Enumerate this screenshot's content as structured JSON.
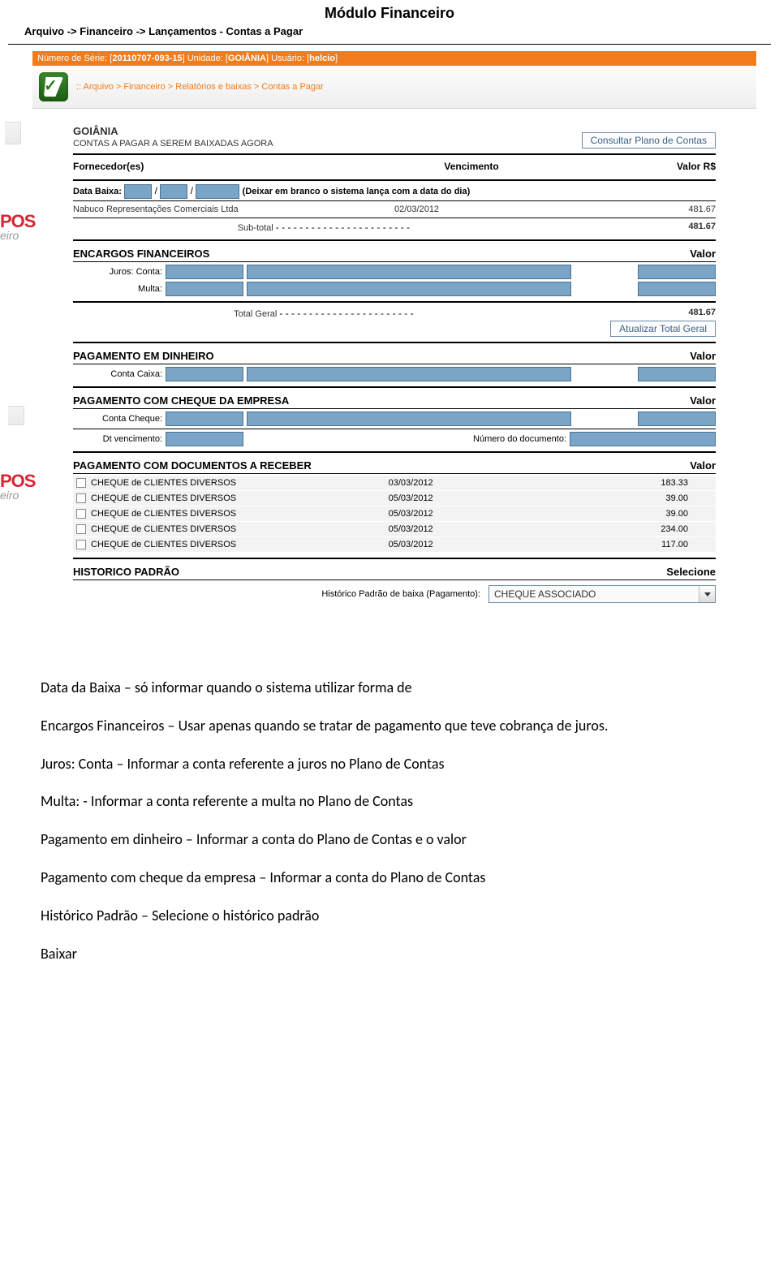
{
  "doc": {
    "title": "Módulo Financeiro",
    "path": "Arquivo -> Financeiro -> Lançamentos - Contas a Pagar"
  },
  "header": {
    "serial_label": "Número de Série:",
    "serial": "20110707-093-15",
    "unit_label": "Unidade:",
    "unit": "GOIÂNIA",
    "user_label": "Usuário:",
    "user": "helcio"
  },
  "breadcrumb": ":: Arquivo > Financeiro > Relatórios e baixas > Contas a Pagar",
  "main": {
    "unit_name": "GOIÂNIA",
    "subtitle": "CONTAS A PAGAR A SEREM BAIXADAS AGORA",
    "btn_plano": "Consultar Plano de Contas",
    "cols": {
      "fornecedor": "Fornecedor(es)",
      "vencimento": "Vencimento",
      "valor": "Valor R$"
    },
    "data_baixa_label": "Data Baixa:",
    "data_baixa_hint": "(Deixar em branco o sistema lança com a data do dia)",
    "fornecedor_row": {
      "name": "Nabuco Representações Comerciais Ltda",
      "date": "02/03/2012",
      "value": "481.67"
    },
    "subtotal_label": "Sub-total",
    "subtotal_value": "481.67",
    "encargos_title": "ENCARGOS FINANCEIROS",
    "valor_label": "Valor",
    "juros_label": "Juros: Conta:",
    "multa_label": "Multa:",
    "total_label": "Total Geral",
    "total_value": "481.67",
    "btn_atualizar": "Atualizar Total Geral",
    "pag_dinheiro_title": "PAGAMENTO EM DINHEIRO",
    "conta_caixa_label": "Conta Caixa:",
    "pag_cheque_title": "PAGAMENTO COM CHEQUE DA EMPRESA",
    "conta_cheque_label": "Conta Cheque:",
    "dt_venc_label": "Dt vencimento:",
    "num_doc_label": "Número do documento:",
    "pag_docs_title": "PAGAMENTO COM DOCUMENTOS A RECEBER",
    "docs": [
      {
        "name": "CHEQUE de CLIENTES DIVERSOS",
        "date": "03/03/2012",
        "value": "183.33"
      },
      {
        "name": "CHEQUE de CLIENTES DIVERSOS",
        "date": "05/03/2012",
        "value": "39.00"
      },
      {
        "name": "CHEQUE de CLIENTES DIVERSOS",
        "date": "05/03/2012",
        "value": "39.00"
      },
      {
        "name": "CHEQUE de CLIENTES DIVERSOS",
        "date": "05/03/2012",
        "value": "234.00"
      },
      {
        "name": "CHEQUE de CLIENTES DIVERSOS",
        "date": "05/03/2012",
        "value": "117.00"
      }
    ],
    "hist_title": "HISTORICO PADRÃO",
    "hist_selecione": "Selecione",
    "hist_label": "Histórico Padrão de baixa (Pagamento):",
    "hist_value": "CHEQUE ASSOCIADO"
  },
  "instr": {
    "p1": "Data da Baixa – só informar quando o sistema utilizar forma de",
    "p2": "Encargos Financeiros – Usar apenas quando se tratar de pagamento que teve cobrança de juros.",
    "p3": "Juros: Conta – Informar a conta referente a juros no Plano de Contas",
    "p4": "Multa: - Informar a conta referente a multa no Plano de Contas",
    "p5": "Pagamento em dinheiro – Informar a conta do Plano de Contas e o valor",
    "p6": "Pagamento com cheque da empresa – Informar a conta do Plano de Contas",
    "p7": "Histórico Padrão – Selecione o histórico padrão",
    "p8": "Baixar"
  },
  "wm": {
    "pos": "POS",
    "eiro": "eiro"
  }
}
